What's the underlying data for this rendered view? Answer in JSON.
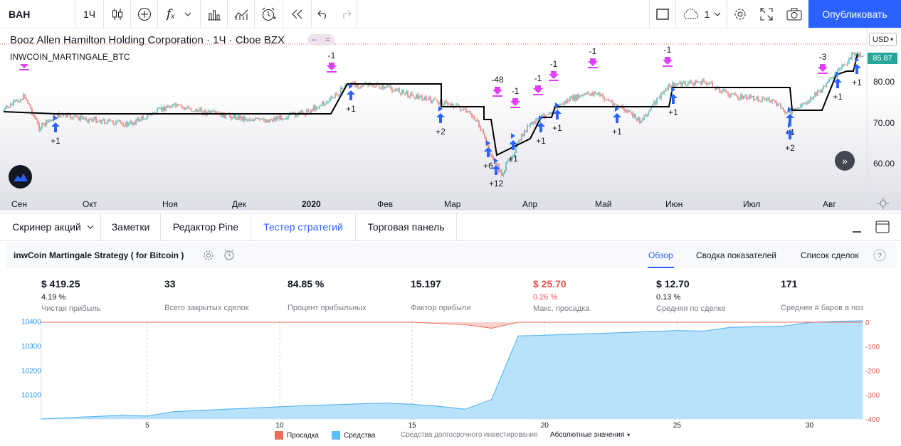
{
  "toolbar": {
    "symbol": "BAH",
    "interval": "1Ч",
    "layout_count": "1",
    "publish_label": "Опубликовать",
    "icons": [
      "candles-icon",
      "add-compare-icon",
      "indicators-icon",
      "templates-icon",
      "alert-icon",
      "replay-icon",
      "undo-icon",
      "redo-icon",
      "layout-icon",
      "cloud-icon",
      "gear-icon",
      "fullscreen-icon",
      "camera-icon"
    ]
  },
  "chart": {
    "title": "Booz Allen Hamilton Holding Corporation · 1Ч · Cboe BZX",
    "indicator_label": "INWCOIN_MARTINGALE_BTC",
    "currency": "USD",
    "last_price": "85.87",
    "y_axis": [
      "80.00",
      "70.00",
      "60.00"
    ],
    "x_axis": [
      "Сен",
      "Окт",
      "Ноя",
      "Дек",
      "2020",
      "Фев",
      "Мар",
      "Апр",
      "Май",
      "Июн",
      "Июл",
      "Авг"
    ],
    "trade_labels": [
      "-1",
      "+1",
      "-1",
      "+1",
      "+2",
      "-48",
      "+6",
      "+12",
      "+1",
      "-1",
      "-1",
      "+1",
      "+1",
      "-1",
      "+1",
      "-1",
      "+1",
      "-1",
      "+1",
      "+2",
      "-3",
      "+1",
      "+1"
    ],
    "colors": {
      "up": "#26a69a",
      "down": "#ef5350",
      "buy_arrow": "#2962ff",
      "sell_arrow": "#e040fb",
      "position_line": "#000000"
    }
  },
  "bottom_tabs": {
    "screener": "Скринер акций",
    "notes": "Заметки",
    "pine_editor": "Редактор Pine",
    "strategy_tester": "Тестер стратегий",
    "trading_panel": "Торговая панель"
  },
  "strategy": {
    "name": "inwCoin Martingale Strategy ( for Bitcoin )",
    "tabs": [
      "Обзор",
      "Сводка показателей",
      "Список сделок"
    ],
    "stats": [
      {
        "value": "$ 419.25",
        "pct": "4.19 %",
        "label": "Чистая прибыль"
      },
      {
        "value": "33",
        "pct": "",
        "label": "Всего закрытых сделок"
      },
      {
        "value": "84.85 %",
        "pct": "",
        "label": "Процент прибыльных"
      },
      {
        "value": "15.197",
        "pct": "",
        "label": "Фактор прибыли"
      },
      {
        "value": "$ 25.70",
        "pct": "0.26 %",
        "label": "Макс. просадка"
      },
      {
        "value": "$ 12.70",
        "pct": "0.13 %",
        "label": "Средняя по сделке"
      },
      {
        "value": "171",
        "pct": "",
        "label": "Среднее # баров в позиции"
      }
    ]
  },
  "chart_data": {
    "type": "area",
    "x": [
      1,
      2,
      3,
      4,
      5,
      6,
      7,
      8,
      9,
      10,
      11,
      12,
      13,
      14,
      15,
      16,
      17,
      18,
      19,
      20,
      21,
      22,
      23,
      24,
      25,
      26,
      27,
      28,
      29,
      30,
      31,
      32
    ],
    "series": [
      {
        "name": "Средства",
        "values": [
          10000,
          10005,
          10010,
          10015,
          10012,
          10030,
          10035,
          10040,
          10045,
          10050,
          10055,
          10058,
          10062,
          10065,
          10060,
          10052,
          10040,
          10080,
          10340,
          10343,
          10347,
          10350,
          10354,
          10358,
          10362,
          10360,
          10375,
          10378,
          10380,
          10395,
          10400,
          10402
        ]
      },
      {
        "name": "Просадка",
        "values": [
          0,
          0,
          0,
          0,
          0,
          0,
          0,
          0,
          0,
          0,
          0,
          0,
          0,
          0,
          0,
          -5,
          -10,
          -25,
          0,
          0,
          0,
          0,
          0,
          0,
          0,
          0,
          0,
          0,
          0,
          0,
          0,
          0
        ]
      }
    ],
    "x_ticks": [
      "5",
      "10",
      "15",
      "20",
      "25",
      "30"
    ],
    "y_left_ticks": [
      "10400",
      "10300",
      "10200",
      "10100"
    ],
    "y_right_ticks": [
      "0",
      "-100",
      "-200",
      "-300",
      "-400"
    ],
    "legend": [
      "Просадка",
      "Средства",
      "Средства долгосрочного инвестирования",
      "Абсолютные значения"
    ]
  }
}
